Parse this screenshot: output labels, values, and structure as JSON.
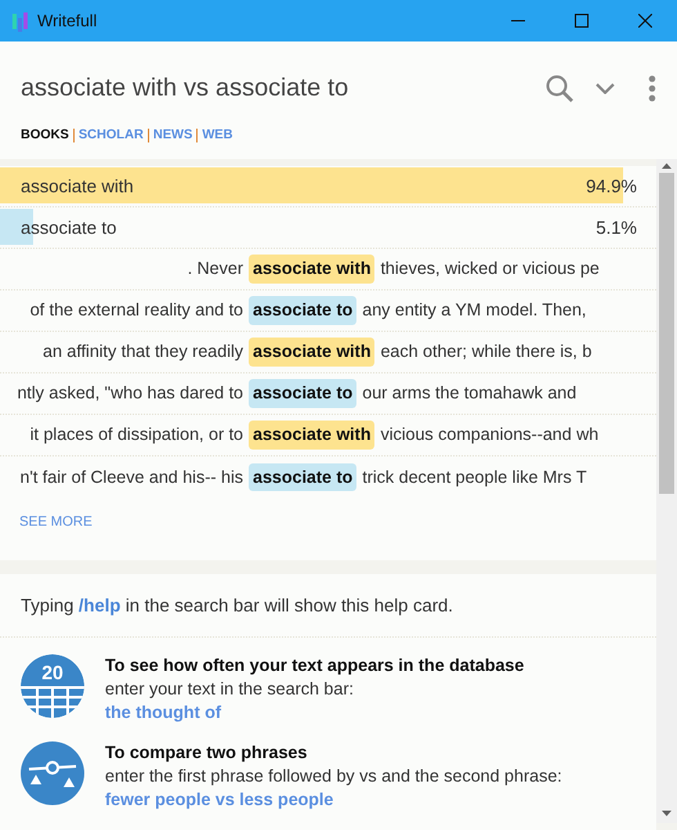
{
  "window": {
    "title": "Writefull"
  },
  "query": "associate with vs associate to",
  "sources": [
    {
      "label": "BOOKS",
      "selected": true
    },
    {
      "label": "SCHOLAR",
      "selected": false
    },
    {
      "label": "NEWS",
      "selected": false
    },
    {
      "label": "WEB",
      "selected": false
    }
  ],
  "results": [
    {
      "phrase": "associate with",
      "percent": "94.9%",
      "level": 0.949,
      "color": "#fde38f"
    },
    {
      "phrase": "associate to",
      "percent": "5.1%",
      "level": 0.051,
      "color": "#c6e7f3"
    }
  ],
  "examples": [
    {
      "before": ". Never",
      "match": "associate with",
      "after": "thieves, wicked or vicious pe",
      "color": "#fde38f"
    },
    {
      "before": "of the external reality and to",
      "match": "associate to",
      "after": "any entity a YM model. Then,",
      "color": "#c6e7f3"
    },
    {
      "before": "an affinity that they readily",
      "match": "associate with",
      "after": "each other; while there is, b",
      "color": "#fde38f"
    },
    {
      "before": "ntly asked, \"who has dared to",
      "match": "associate to",
      "after": "our arms the tomahawk and",
      "color": "#c6e7f3"
    },
    {
      "before": "it places of dissipation, or to",
      "match": "associate with",
      "after": "vicious companions--and wh",
      "color": "#fde38f"
    },
    {
      "before": "n't fair of Cleeve and his-- his",
      "match": "associate to",
      "after": "trick decent people like Mrs T",
      "color": "#c6e7f3"
    }
  ],
  "see_more": "SEE MORE",
  "help": {
    "intro": "Typing **/help** in the search bar will show this help card.",
    "tips": [
      {
        "kind": "count",
        "icon_label": "20",
        "title": "To see how often your text appears in the database",
        "text": "enter your text in the search bar:",
        "example": "the thought of"
      },
      {
        "kind": "compare",
        "title": "To compare two phrases",
        "text": "enter the first phrase followed by vs and the second phrase:",
        "example": "fewer people vs less people"
      }
    ]
  }
}
